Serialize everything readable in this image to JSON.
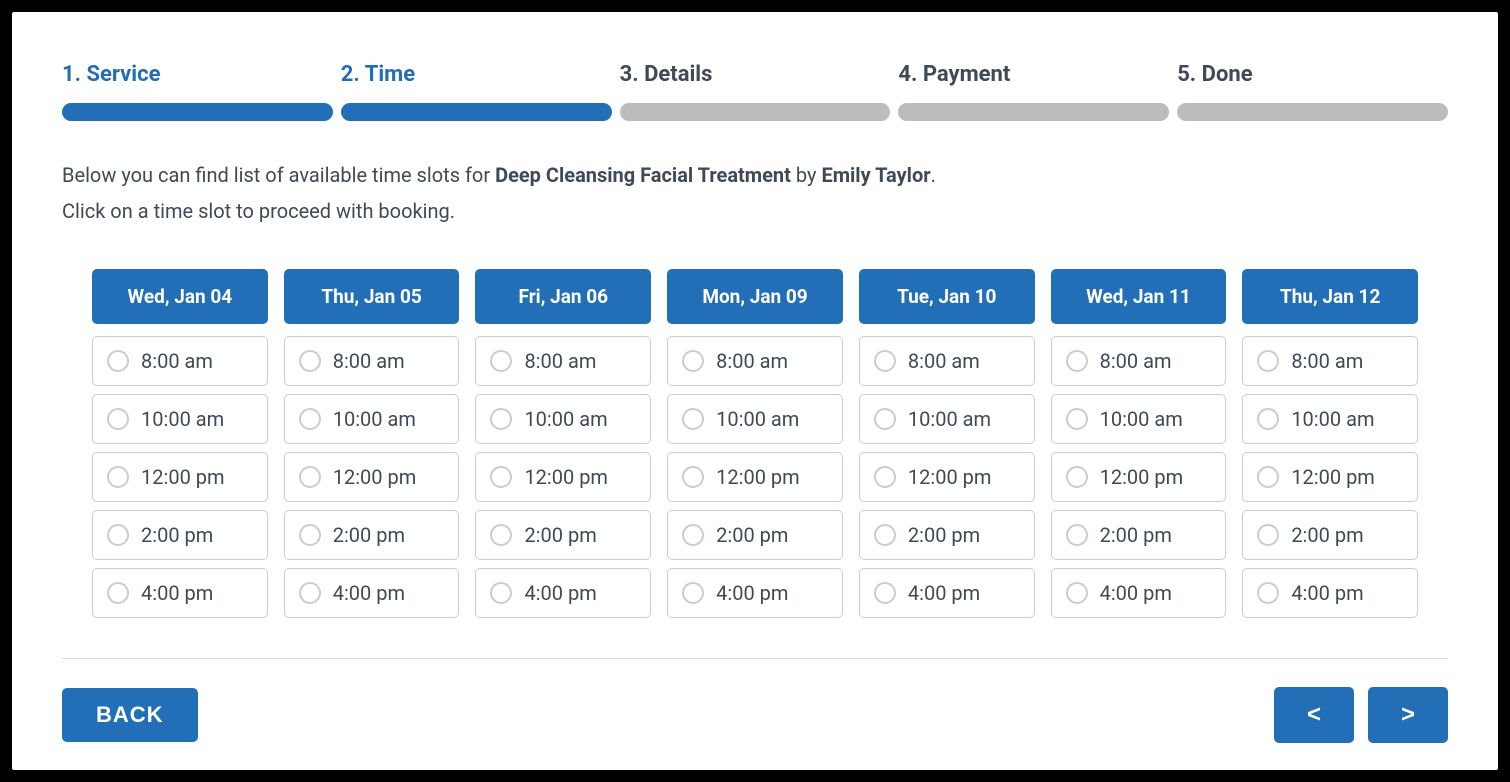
{
  "steps": [
    {
      "label": "1. Service",
      "state": "done"
    },
    {
      "label": "2. Time",
      "state": "active"
    },
    {
      "label": "3. Details",
      "state": "pending"
    },
    {
      "label": "4. Payment",
      "state": "pending"
    },
    {
      "label": "5. Done",
      "state": "pending"
    }
  ],
  "info": {
    "prefix": "Below you can find list of available time slots for ",
    "service": "Deep Cleansing Facial Treatment",
    "by": " by ",
    "staff": "Emily Taylor",
    "suffix": ".",
    "line2": "Click on a time slot to proceed with booking."
  },
  "days": [
    {
      "label": "Wed, Jan 04",
      "slots": [
        "8:00 am",
        "10:00 am",
        "12:00 pm",
        "2:00 pm",
        "4:00 pm"
      ]
    },
    {
      "label": "Thu, Jan 05",
      "slots": [
        "8:00 am",
        "10:00 am",
        "12:00 pm",
        "2:00 pm",
        "4:00 pm"
      ]
    },
    {
      "label": "Fri, Jan 06",
      "slots": [
        "8:00 am",
        "10:00 am",
        "12:00 pm",
        "2:00 pm",
        "4:00 pm"
      ]
    },
    {
      "label": "Mon, Jan 09",
      "slots": [
        "8:00 am",
        "10:00 am",
        "12:00 pm",
        "2:00 pm",
        "4:00 pm"
      ]
    },
    {
      "label": "Tue, Jan 10",
      "slots": [
        "8:00 am",
        "10:00 am",
        "12:00 pm",
        "2:00 pm",
        "4:00 pm"
      ]
    },
    {
      "label": "Wed, Jan 11",
      "slots": [
        "8:00 am",
        "10:00 am",
        "12:00 pm",
        "2:00 pm",
        "4:00 pm"
      ]
    },
    {
      "label": "Thu, Jan 12",
      "slots": [
        "8:00 am",
        "10:00 am",
        "12:00 pm",
        "2:00 pm",
        "4:00 pm"
      ]
    }
  ],
  "buttons": {
    "back": "BACK",
    "prev": "<",
    "next": ">"
  }
}
